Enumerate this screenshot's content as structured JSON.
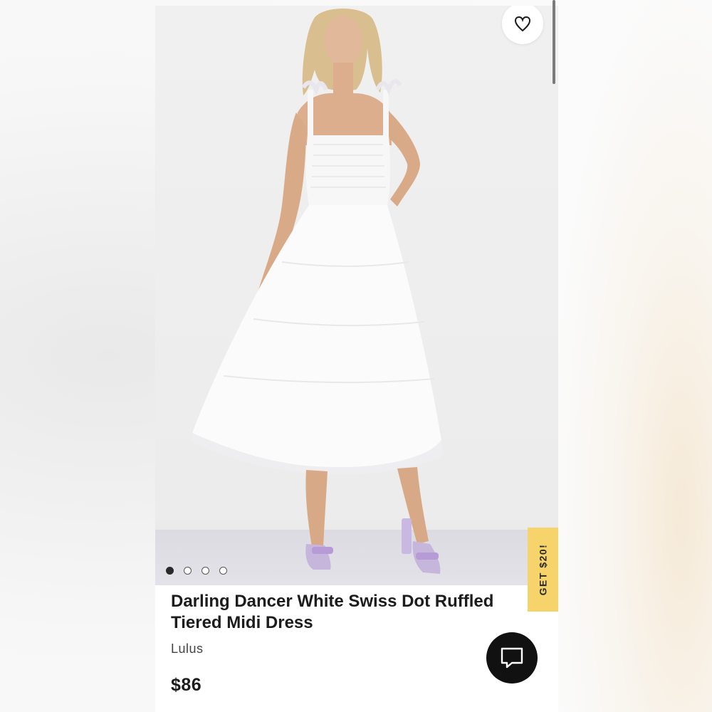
{
  "product": {
    "title": "Darling Dancer White Swiss Dot Ruffled Tiered Midi Dress",
    "brand": "Lulus",
    "price": "$86"
  },
  "gallery": {
    "image_count": 4,
    "active_index": 0
  },
  "promo_tab": {
    "label": "GET $20!"
  },
  "icons": {
    "wishlist": "heart-outline-icon",
    "chat": "chat-bubble-icon"
  },
  "colors": {
    "promo_yellow": "#f7d36b",
    "chat_button": "#111111",
    "text": "#1c1c1c"
  }
}
